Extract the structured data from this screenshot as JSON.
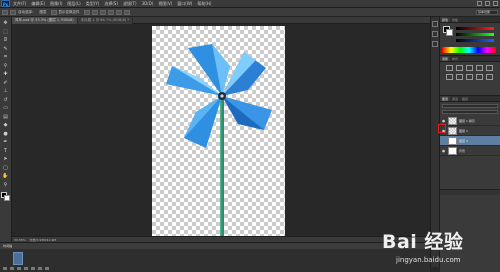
{
  "app": {
    "logo": "Ps"
  },
  "menubar": {
    "items": [
      "文件(F)",
      "编辑(E)",
      "图像(I)",
      "图层(L)",
      "类型(Y)",
      "选择(S)",
      "滤镜(T)",
      "3D(D)",
      "视图(V)",
      "窗口(W)",
      "帮助(H)"
    ]
  },
  "options": {
    "labels": [
      "自动选择：",
      "图层",
      "显示变换控件"
    ],
    "workspace": "基本功能"
  },
  "document": {
    "tabs": [
      {
        "label": "风车.psd @ 33.3% (图层 1, RGB/8)",
        "active": true
      },
      {
        "label": "未标题-1 @ 66.7% (RGB/8) *",
        "active": false
      }
    ]
  },
  "status": {
    "zoom": "33.33%",
    "info": "文档:5.93M/11.9M"
  },
  "timeline": {
    "title": "时间轴"
  },
  "panels": {
    "color_tabs": [
      "颜色",
      "色板"
    ],
    "adjust_tabs": [
      "调整",
      "样式"
    ],
    "adjust_title": "添加调整",
    "layers_tabs": [
      "图层",
      "通道",
      "路径"
    ],
    "layers": [
      {
        "name": "图层 1 拷贝",
        "selected": false
      },
      {
        "name": "图层 1",
        "selected": false
      },
      {
        "name": "图层 2",
        "selected": true
      },
      {
        "name": "背景",
        "selected": false
      }
    ]
  },
  "colors": {
    "accent": "#3ba0ff",
    "selection": "#5e7fa3",
    "highlight_box": "#e02020",
    "pinwheel": "#2f8fe0",
    "stick": "#2f8a6e"
  },
  "watermark": {
    "text": "Bai 经验",
    "url": "jingyan.baidu.com"
  }
}
